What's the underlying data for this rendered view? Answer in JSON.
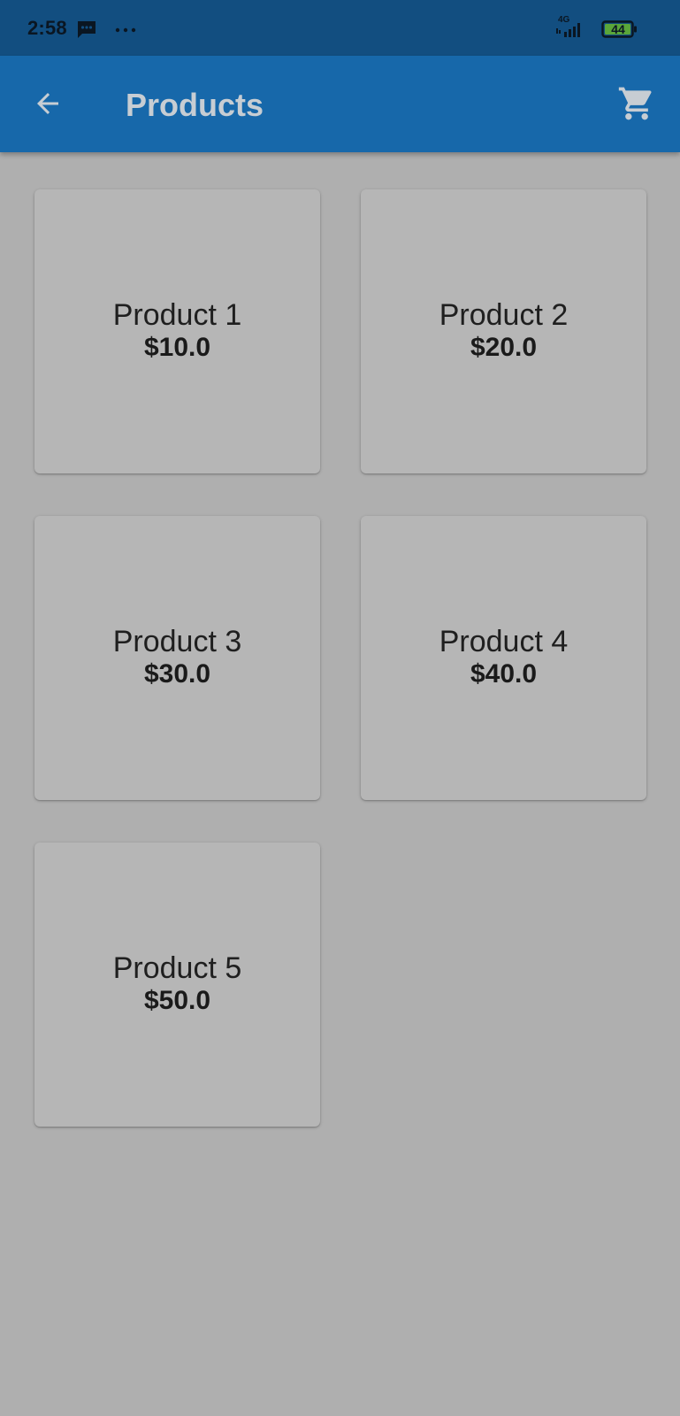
{
  "status_bar": {
    "time": "2:58",
    "network_label": "4G",
    "battery_level": "44",
    "icons": [
      "message-icon",
      "more-dots-icon",
      "signal-icon",
      "battery-icon"
    ]
  },
  "app_bar": {
    "title": "Products",
    "back_icon": "arrow-back-icon",
    "cart_icon": "shopping-cart-icon"
  },
  "products": [
    {
      "name": "Product 1",
      "price": "$10.0"
    },
    {
      "name": "Product 2",
      "price": "$20.0"
    },
    {
      "name": "Product 3",
      "price": "$30.0"
    },
    {
      "name": "Product 4",
      "price": "$40.0"
    },
    {
      "name": "Product 5",
      "price": "$50.0"
    }
  ],
  "colors": {
    "status_bar_bg": "#124e80",
    "app_bar_bg": "#1768aa",
    "app_bar_text": "#c7cdd3",
    "page_bg": "#afafaf",
    "card_bg": "#b6b6b6",
    "battery_fill": "#5aa63a"
  }
}
